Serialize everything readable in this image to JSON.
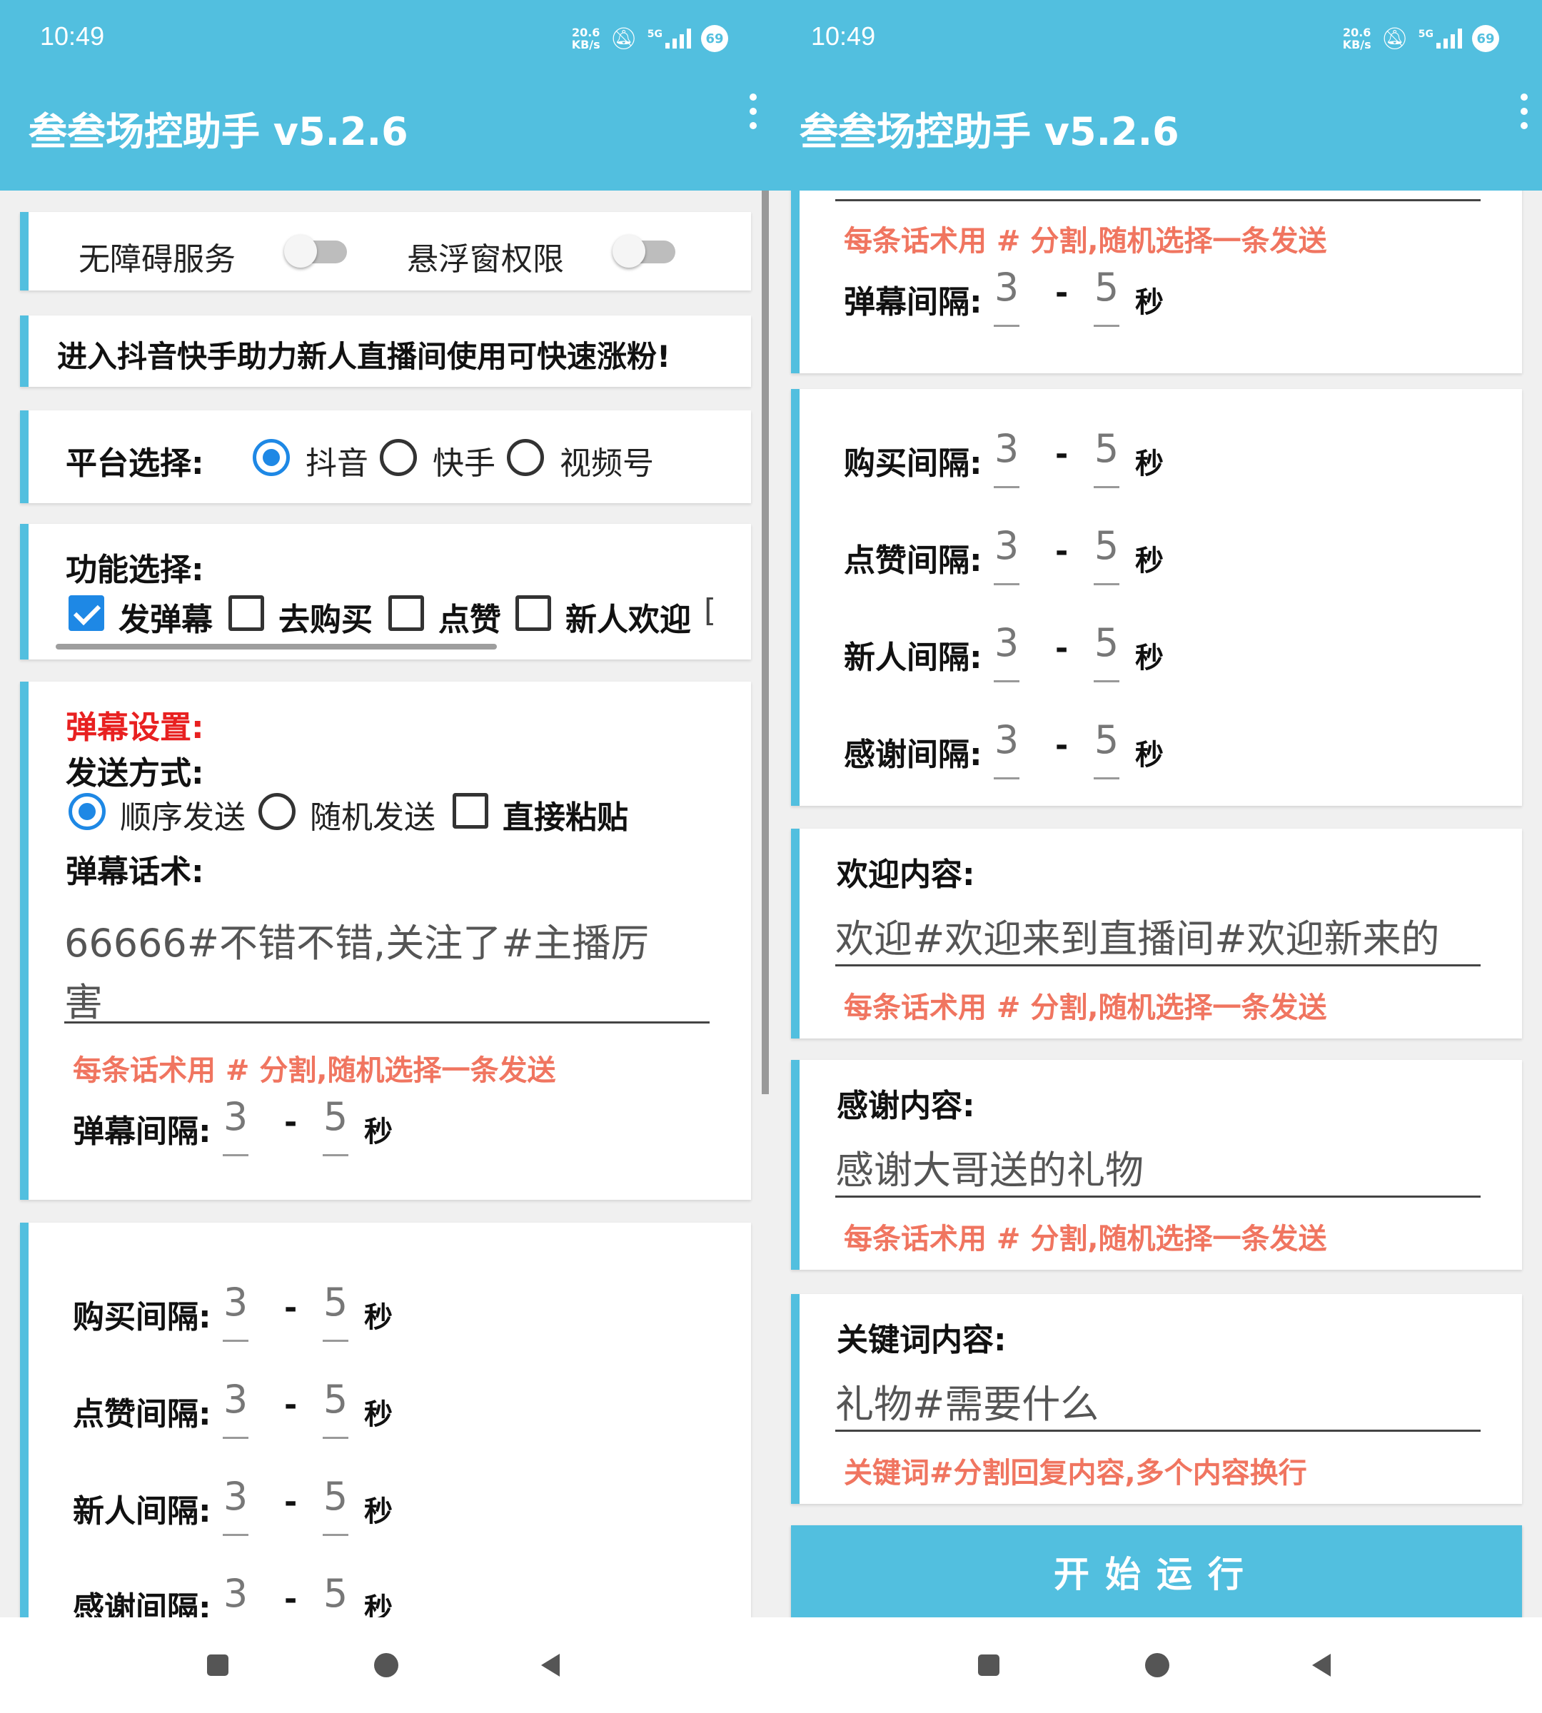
{
  "status_bar": {
    "time": "10:49",
    "speed_value": "20.6",
    "speed_unit": "KB/s",
    "network": "5G",
    "battery": "69"
  },
  "app": {
    "title": "叁叁场控助手 v5.2.6"
  },
  "permissions": {
    "accessibility_label": "无障碍服务",
    "accessibility_on": false,
    "overlay_label": "悬浮窗权限",
    "overlay_on": false
  },
  "notice": "进入抖音快手助力新人直播间使用可快速涨粉!",
  "platform": {
    "label": "平台选择:",
    "options": [
      "抖音",
      "快手",
      "视频号"
    ],
    "selected": "抖音"
  },
  "features": {
    "label": "功能选择:",
    "items": [
      {
        "label": "发弹幕",
        "checked": true
      },
      {
        "label": "去购买",
        "checked": false
      },
      {
        "label": "点赞",
        "checked": false
      },
      {
        "label": "新人欢迎",
        "checked": false
      }
    ],
    "overflow_glyph": "["
  },
  "danmu": {
    "section_title": "弹幕设置:",
    "send_mode_label": "发送方式:",
    "modes": [
      "顺序发送",
      "随机发送"
    ],
    "selected_mode": "顺序发送",
    "paste_label": "直接粘贴",
    "paste_checked": false,
    "script_label": "弹幕话术:",
    "script_value_line1": "66666#不错不错,关注了#主播厉",
    "script_value_line2": "害",
    "hint": "每条话术用 # 分割,随机选择一条发送"
  },
  "intervals": {
    "danmu": {
      "label": "弹幕间隔:",
      "min": "3",
      "max": "5"
    },
    "buy": {
      "label": "购买间隔:",
      "min": "3",
      "max": "5"
    },
    "like": {
      "label": "点赞间隔:",
      "min": "3",
      "max": "5"
    },
    "newcomer": {
      "label": "新人间隔:",
      "min": "3",
      "max": "5"
    },
    "thanks": {
      "label": "感谢间隔:",
      "min": "3",
      "max": "5"
    },
    "dash": "-",
    "unit": "秒"
  },
  "welcome": {
    "label": "欢迎内容:",
    "value": "欢迎#欢迎来到直播间#欢迎新来的",
    "hint": "每条话术用 # 分割,随机选择一条发送"
  },
  "thanks_content": {
    "label": "感谢内容:",
    "value": "感谢大哥送的礼物",
    "hint": "每条话术用 # 分割,随机选择一条发送"
  },
  "keyword": {
    "label": "关键词内容:",
    "value": "礼物#需要什么",
    "hint": "关键词#分割回复内容,多个内容换行"
  },
  "run_button": "开始运行",
  "colors": {
    "accent": "#52bfdf",
    "radio_checked": "#1e88e5",
    "hint": "#f07560",
    "section_red": "#e82020"
  }
}
